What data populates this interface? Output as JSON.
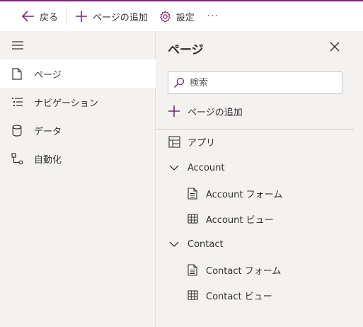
{
  "toolbar": {
    "back_label": "戻る",
    "add_page_label": "ページの追加",
    "settings_label": "設定",
    "more_label": "···"
  },
  "nav": {
    "items": [
      {
        "label": "ページ",
        "icon": "page-icon",
        "active": true
      },
      {
        "label": "ナビゲーション",
        "icon": "navigation-icon",
        "active": false
      },
      {
        "label": "データ",
        "icon": "database-icon",
        "active": false
      },
      {
        "label": "自動化",
        "icon": "automation-icon",
        "active": false
      }
    ]
  },
  "panel": {
    "title": "ページ",
    "search_placeholder": "検索",
    "add_page_label": "ページの追加",
    "tree": [
      {
        "label": "アプリ",
        "icon": "app-designer-icon"
      },
      {
        "label": "Account",
        "icon": "chevron-down-icon"
      },
      {
        "label": "Account フォーム",
        "icon": "form-icon"
      },
      {
        "label": "Account ビュー",
        "icon": "grid-view-icon"
      },
      {
        "label": "Contact",
        "icon": "chevron-down-icon"
      },
      {
        "label": "Contact フォーム",
        "icon": "form-icon"
      },
      {
        "label": "Contact ビュー",
        "icon": "grid-view-icon"
      }
    ]
  },
  "colors": {
    "accent": "#742774",
    "active_background": "#ffffff",
    "surface": "#f3f2f1"
  }
}
